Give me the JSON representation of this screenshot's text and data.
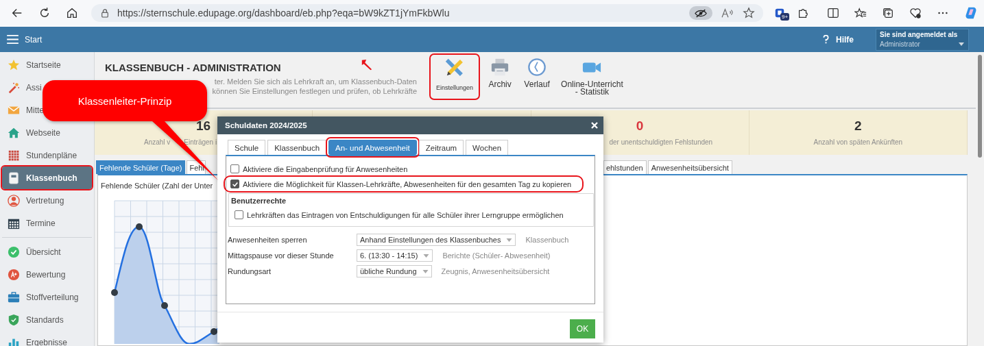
{
  "browser": {
    "url": "https://sternschule.edupage.org/dashboard/eb.php?eqa=bW9kZT1jYmFkbWlu",
    "badge": "9+"
  },
  "app_bar": {
    "menu_label": "Start",
    "help": "Hilfe",
    "account": {
      "label": "Sie sind angemeldet als",
      "value": "Administrator"
    }
  },
  "sidebar": {
    "groups": [
      {
        "items": [
          {
            "label": "Startseite",
            "selected": false,
            "highlighted": false
          },
          {
            "label": "Assi",
            "selected": false,
            "highlighted": false
          },
          {
            "label": "Mitte",
            "selected": false,
            "highlighted": false
          },
          {
            "label": "Webseite",
            "selected": false,
            "highlighted": false
          },
          {
            "label": "Stundenpläne",
            "selected": false,
            "highlighted": false
          },
          {
            "label": "Klassenbuch",
            "selected": true,
            "highlighted": true
          },
          {
            "label": "Vertretung",
            "selected": false,
            "highlighted": false
          },
          {
            "label": "Termine",
            "selected": false,
            "highlighted": false
          }
        ]
      },
      {
        "items": [
          {
            "label": "Übersicht",
            "selected": false,
            "highlighted": false
          },
          {
            "label": "Bewertung",
            "selected": false,
            "highlighted": false
          },
          {
            "label": "Stoffverteilung",
            "selected": false,
            "highlighted": false
          },
          {
            "label": "Standards",
            "selected": false,
            "highlighted": false
          },
          {
            "label": "Ergebnisse",
            "selected": false,
            "highlighted": false
          }
        ]
      }
    ]
  },
  "header": {
    "title": "KLASSENBUCH - ADMINISTRATION",
    "description": [
      [
        "ter. Melden Sie sich als Lehrkraft an, um Klassenbuch-Daten"
      ],
      [
        "können Sie Einstellungen festlegen und prüfen, ob Lehrkräfte"
      ]
    ]
  },
  "toolbar": [
    {
      "lines": [
        "Einstellungen"
      ],
      "highlighted": true
    },
    {
      "lines": [
        "Archiv"
      ],
      "highlighted": false
    },
    {
      "lines": [
        "Verlauf"
      ],
      "highlighted": false
    },
    {
      "lines": [
        "Online-Unterricht",
        "- Statistik"
      ],
      "highlighted": false
    }
  ],
  "stats": [
    {
      "value": "16",
      "label": [
        "Anzahl v",
        "Einträgen i"
      ],
      "color": "#333333"
    },
    {
      "value": "0",
      "label": [
        "der unentschuldigten Fehlstunden"
      ],
      "color": "#d9363e"
    },
    {
      "value": "2",
      "label": [
        "Anzahl von späten Ankünften"
      ],
      "color": "#333333"
    }
  ],
  "tabs": [
    {
      "label": "Fehlende Schüler (Tage)",
      "selected": true
    },
    {
      "label": "Fehl",
      "selected": false
    },
    {
      "label": "ehlstunden",
      "selected": false
    },
    {
      "label": "Anwesenheitsübersicht",
      "selected": false
    }
  ],
  "chart_title": "Fehlende Schüler (Zahl der Unter",
  "dialog": {
    "title": "Schuldaten 2024/2025",
    "tabs": [
      {
        "label": "Schule",
        "selected": false,
        "highlighted": false
      },
      {
        "label": "Klassenbuch",
        "selected": false,
        "highlighted": false
      },
      {
        "label": "An- und Abwesenheit",
        "selected": true,
        "highlighted": true
      },
      {
        "label": "Zeitraum",
        "selected": false,
        "highlighted": false
      },
      {
        "label": "Wochen",
        "selected": false,
        "highlighted": false
      }
    ],
    "options": [
      {
        "label": "Aktiviere die Eingabenprüfung für Anwesenheiten",
        "checked": false,
        "highlighted": false
      },
      {
        "label": "Aktiviere die Möglichkeit für Klassen-Lehrkräfte, Abwesenheiten für den gesamten Tag zu kopieren",
        "checked": true,
        "highlighted": true
      }
    ],
    "rights": {
      "title": "Benutzerrechte",
      "options": [
        {
          "label": "Lehrkräften das Eintragen von Entschuldigungen für alle Schüler ihrer Lerngruppe ermöglichen",
          "checked": false
        }
      ]
    },
    "settings": [
      {
        "label": "Anwesenheiten sperren",
        "value": "Anhand Einstellungen des Klassenbuches",
        "note": "Klassenbuch"
      },
      {
        "label": "Mittagspause vor dieser Stunde",
        "value": "6. (13:30 - 14:15)",
        "note": "Berichte (Schüler- Abwesenheit)"
      },
      {
        "label": "Rundungsart",
        "value": "übliche Rundung",
        "note": "Zeugnis, Anwesenheitsübersicht"
      }
    ],
    "ok": "OK"
  },
  "callout": {
    "text": "Klassenleiter-Prinzip"
  }
}
